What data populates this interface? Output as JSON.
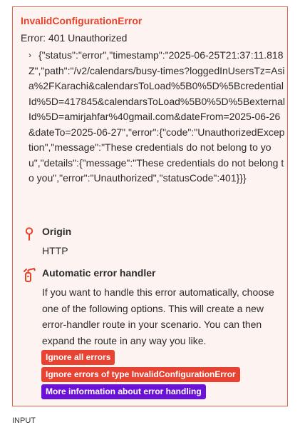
{
  "error": {
    "title": "InvalidConfigurationError",
    "subtitle": "Error: 401 Unauthorized",
    "detail_chevron": "›",
    "detail": "{\"status\":\"error\",\"timestamp\":\"2025-06-25T21:37:11.818Z\",\"path\":\"/v2/calendars/busy-times?loggedInUsersTz=Asia%2FKarachi&calendarsToLoad%5B0%5D%5BcredentialId%5D=417845&calendarsToLoad%5B0%5D%5BexternalId%5D=amirjahfar%40gmail.com&dateFrom=2025-06-26&dateTo=2025-06-27\",\"error\":{\"code\":\"UnauthorizedException\",\"message\":\"These credentials do not belong to you\",\"details\":{\"message\":\"These credentials do not belong to you\",\"error\":\"Unauthorized\",\"statusCode\":401}}}"
  },
  "origin": {
    "icon": "location-pin-icon",
    "label": "Origin",
    "value": "HTTP"
  },
  "handler": {
    "icon": "fire-extinguisher-icon",
    "label": "Automatic error handler",
    "description": "If you want to handle this error automatically, choose one of the following options. This will create a new error-handler route in your scenario. You can then expand the route in any way you like."
  },
  "buttons": {
    "ignore_all": "Ignore all errors",
    "ignore_type": "Ignore errors of type InvalidConfigurationError",
    "more_info": "More information about error handling"
  },
  "footer": {
    "label": "INPUT"
  },
  "colors": {
    "accent_red": "#e5432c",
    "button_red": "#e84232",
    "button_purple": "#6b12d6",
    "panel_bg": "#fdf3f1",
    "panel_border": "#e0624f"
  }
}
